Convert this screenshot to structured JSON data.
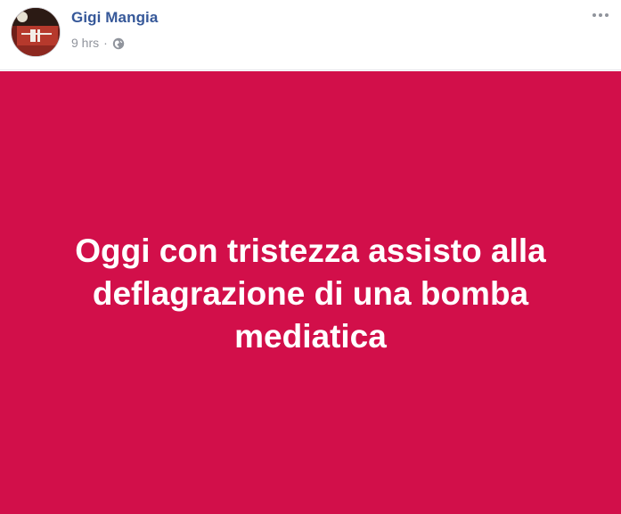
{
  "post": {
    "author": "Gigi Mangia",
    "timestamp": "9 hrs",
    "separator": "·",
    "privacy_icon": "globe-icon",
    "more_icon": "more-options-icon",
    "background_color": "#d20f4a",
    "text_color": "#ffffff",
    "message": "Oggi con tristezza assisto alla deflagrazione di una bomba mediatica"
  },
  "avatar": {
    "icon": "profile-picture"
  }
}
